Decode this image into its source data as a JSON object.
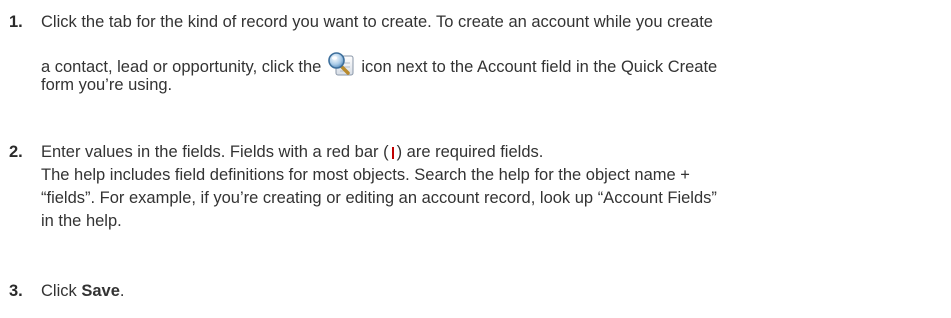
{
  "steps": [
    {
      "number": "1.",
      "lines": [
        "Click the tab for the kind of record you want to create. To create an account while you create",
        "a contact, lead or opportunity, click the",
        "icon next to the Account field in the Quick Create",
        "form you’re using."
      ],
      "icon": "lookup-magnifier-icon"
    },
    {
      "number": "2.",
      "line1_before": "Enter values in the fields. Fields with a red bar (",
      "line1_after": ") are required fields.",
      "lines": [
        "The help includes field definitions for most objects. Search the help for the object name +",
        "“fields”. For example, if you’re creating or editing an account record, look up “Account Fields”",
        "in the help."
      ],
      "required_color": "#c00000"
    },
    {
      "number": "3.",
      "before": "Click ",
      "bold": "Save",
      "after": "."
    }
  ]
}
